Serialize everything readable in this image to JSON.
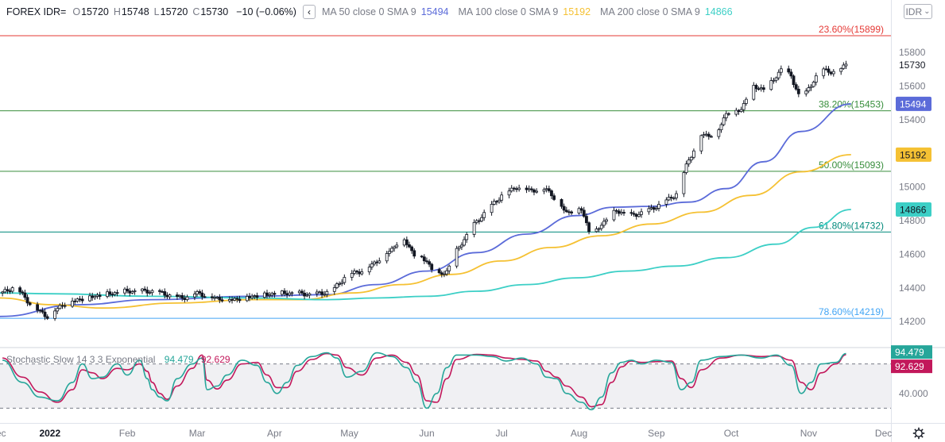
{
  "header": {
    "symbol": "FOREX IDR=",
    "open_label": "O",
    "open": "15720",
    "high_label": "H",
    "high": "15748",
    "low_label": "L",
    "low": "15720",
    "close_label": "C",
    "close": "15730",
    "change": "−10 (−0.06%)",
    "collapse_glyph": "‹",
    "ma50_label": "MA 50 close 0 SMA 9",
    "ma50_value": "15494",
    "ma100_label": "MA 100 close 0 SMA 9",
    "ma100_value": "15192",
    "ma200_label": "MA 200 close 0 SMA 9",
    "ma200_value": "14866"
  },
  "currency_select": {
    "value": "IDR",
    "glyph": "⌄"
  },
  "stochastic": {
    "title": "Stochastic Slow 14 3 3 Exponential",
    "k_value": "94.479",
    "d_value": "92.629"
  },
  "colors": {
    "ma50": "#5b6bd9",
    "ma100": "#f5c133",
    "ma200": "#3ccfc6",
    "fib_red": "#e53935",
    "fib_green": "#388e3c",
    "fib_teal": "#00897b",
    "fib_blue": "#42a5f5",
    "stoch_k": "#26a69a",
    "stoch_d": "#c2185b",
    "candle": "#131722",
    "last_price_bg": "#131722"
  },
  "chart_data": {
    "type": "candlestick",
    "y_range": [
      14050,
      15970
    ],
    "price_ticks": [
      "15800",
      "15600",
      "15400",
      "15200",
      "15000",
      "14800",
      "14600",
      "14400",
      "14200"
    ],
    "x_labels": [
      {
        "label": "Dec",
        "day": -2
      },
      {
        "label": "2022",
        "day": 19
      },
      {
        "label": "Feb",
        "day": 50
      },
      {
        "label": "Mar",
        "day": 78
      },
      {
        "label": "Apr",
        "day": 109
      },
      {
        "label": "May",
        "day": 139
      },
      {
        "label": "Jun",
        "day": 170
      },
      {
        "label": "Jul",
        "day": 200
      },
      {
        "label": "Aug",
        "day": 231
      },
      {
        "label": "Sep",
        "day": 262
      },
      {
        "label": "Oct",
        "day": 292
      },
      {
        "label": "Nov",
        "day": 323
      },
      {
        "label": "Dec",
        "day": 353
      }
    ],
    "x_range": [
      -1,
      356
    ],
    "close_anchors": [
      [
        0,
        14370
      ],
      [
        5,
        14410
      ],
      [
        12,
        14290
      ],
      [
        18,
        14230
      ],
      [
        24,
        14300
      ],
      [
        30,
        14330
      ],
      [
        40,
        14360
      ],
      [
        50,
        14380
      ],
      [
        60,
        14380
      ],
      [
        66,
        14360
      ],
      [
        72,
        14340
      ],
      [
        78,
        14370
      ],
      [
        85,
        14340
      ],
      [
        92,
        14330
      ],
      [
        100,
        14350
      ],
      [
        108,
        14365
      ],
      [
        116,
        14370
      ],
      [
        124,
        14360
      ],
      [
        132,
        14380
      ],
      [
        138,
        14480
      ],
      [
        145,
        14505
      ],
      [
        150,
        14560
      ],
      [
        156,
        14630
      ],
      [
        160,
        14705
      ],
      [
        165,
        14600
      ],
      [
        170,
        14560
      ],
      [
        174,
        14470
      ],
      [
        178,
        14500
      ],
      [
        182,
        14620
      ],
      [
        188,
        14760
      ],
      [
        194,
        14860
      ],
      [
        200,
        14950
      ],
      [
        206,
        15000
      ],
      [
        212,
        14980
      ],
      [
        218,
        14990
      ],
      [
        222,
        14920
      ],
      [
        226,
        14850
      ],
      [
        232,
        14870
      ],
      [
        236,
        14700
      ],
      [
        240,
        14780
      ],
      [
        246,
        14860
      ],
      [
        252,
        14830
      ],
      [
        258,
        14855
      ],
      [
        264,
        14900
      ],
      [
        270,
        14960
      ],
      [
        274,
        15130
      ],
      [
        280,
        15310
      ],
      [
        286,
        15310
      ],
      [
        290,
        15440
      ],
      [
        296,
        15460
      ],
      [
        300,
        15600
      ],
      [
        306,
        15580
      ],
      [
        312,
        15700
      ],
      [
        316,
        15660
      ],
      [
        320,
        15510
      ],
      [
        324,
        15610
      ],
      [
        328,
        15700
      ],
      [
        334,
        15680
      ],
      [
        338,
        15730
      ]
    ],
    "series": [
      {
        "name": "MA 50 close 0 SMA 9",
        "value": 15494,
        "points": [
          [
            -1,
            14230
          ],
          [
            30,
            14300
          ],
          [
            60,
            14330
          ],
          [
            100,
            14350
          ],
          [
            130,
            14360
          ],
          [
            150,
            14420
          ],
          [
            170,
            14500
          ],
          [
            190,
            14610
          ],
          [
            210,
            14720
          ],
          [
            230,
            14830
          ],
          [
            245,
            14880
          ],
          [
            260,
            14885
          ],
          [
            275,
            14910
          ],
          [
            290,
            14990
          ],
          [
            305,
            15150
          ],
          [
            320,
            15330
          ],
          [
            340,
            15494
          ]
        ]
      },
      {
        "name": "MA 100 close 0 SMA 9",
        "value": 15192,
        "points": [
          [
            -1,
            14340
          ],
          [
            20,
            14300
          ],
          [
            40,
            14280
          ],
          [
            70,
            14310
          ],
          [
            100,
            14330
          ],
          [
            120,
            14330
          ],
          [
            140,
            14370
          ],
          [
            160,
            14420
          ],
          [
            180,
            14480
          ],
          [
            200,
            14560
          ],
          [
            220,
            14640
          ],
          [
            240,
            14710
          ],
          [
            260,
            14780
          ],
          [
            280,
            14850
          ],
          [
            300,
            14950
          ],
          [
            320,
            15090
          ],
          [
            340,
            15192
          ]
        ]
      },
      {
        "name": "MA 200 close 0 SMA 9",
        "value": 14866,
        "points": [
          [
            -1,
            14370
          ],
          [
            20,
            14365
          ],
          [
            60,
            14350
          ],
          [
            100,
            14340
          ],
          [
            130,
            14330
          ],
          [
            150,
            14340
          ],
          [
            170,
            14350
          ],
          [
            190,
            14380
          ],
          [
            210,
            14420
          ],
          [
            230,
            14460
          ],
          [
            250,
            14500
          ],
          [
            270,
            14530
          ],
          [
            290,
            14580
          ],
          [
            310,
            14660
          ],
          [
            325,
            14760
          ],
          [
            340,
            14866
          ]
        ]
      }
    ],
    "fib_levels": [
      {
        "label": "23.60%(15899)",
        "value": 15899,
        "color_key": "fib_red"
      },
      {
        "label": "38.20%(15453)",
        "value": 15453,
        "color_key": "fib_green"
      },
      {
        "label": "50.00%(15093)",
        "value": 15093,
        "color_key": "fib_green"
      },
      {
        "label": "61.80%(14732)",
        "value": 14732,
        "color_key": "fib_teal"
      },
      {
        "label": "78.60%(14219)",
        "value": 14219,
        "color_key": "fib_blue"
      }
    ],
    "last_price": {
      "label": "15730",
      "value": 15730
    },
    "ma_badges": [
      {
        "label": "15494",
        "value": 15494,
        "color_key": "ma50",
        "text_color": "#ffffff"
      },
      {
        "label": "15192",
        "value": 15192,
        "color_key": "ma100",
        "text_color": "#131722"
      },
      {
        "label": "14866",
        "value": 14866,
        "color_key": "ma200",
        "text_color": "#131722"
      }
    ],
    "stochastic": {
      "y_range": [
        0,
        100
      ],
      "levels": [
        80,
        20
      ],
      "tick_label": "40.000",
      "k_anchors": [
        [
          0,
          85
        ],
        [
          8,
          55
        ],
        [
          15,
          35
        ],
        [
          22,
          30
        ],
        [
          28,
          55
        ],
        [
          32,
          80
        ],
        [
          36,
          60
        ],
        [
          40,
          62
        ],
        [
          46,
          80
        ],
        [
          50,
          65
        ],
        [
          55,
          85
        ],
        [
          58,
          60
        ],
        [
          60,
          45
        ],
        [
          63,
          35
        ],
        [
          66,
          30
        ],
        [
          70,
          60
        ],
        [
          76,
          80
        ],
        [
          80,
          88
        ],
        [
          82,
          45
        ],
        [
          86,
          50
        ],
        [
          90,
          65
        ],
        [
          96,
          85
        ],
        [
          102,
          78
        ],
        [
          106,
          55
        ],
        [
          110,
          40
        ],
        [
          114,
          55
        ],
        [
          118,
          78
        ],
        [
          124,
          90
        ],
        [
          130,
          95
        ],
        [
          134,
          88
        ],
        [
          138,
          62
        ],
        [
          144,
          70
        ],
        [
          150,
          95
        ],
        [
          156,
          90
        ],
        [
          162,
          75
        ],
        [
          166,
          55
        ],
        [
          170,
          20
        ],
        [
          174,
          40
        ],
        [
          178,
          75
        ],
        [
          182,
          92
        ],
        [
          190,
          92
        ],
        [
          196,
          90
        ],
        [
          202,
          84
        ],
        [
          208,
          88
        ],
        [
          214,
          80
        ],
        [
          218,
          62
        ],
        [
          222,
          60
        ],
        [
          226,
          40
        ],
        [
          232,
          28
        ],
        [
          236,
          18
        ],
        [
          240,
          35
        ],
        [
          244,
          68
        ],
        [
          248,
          82
        ],
        [
          252,
          85
        ],
        [
          256,
          80
        ],
        [
          262,
          85
        ],
        [
          268,
          82
        ],
        [
          272,
          45
        ],
        [
          276,
          55
        ],
        [
          280,
          85
        ],
        [
          288,
          90
        ],
        [
          296,
          92
        ],
        [
          304,
          88
        ],
        [
          310,
          92
        ],
        [
          316,
          78
        ],
        [
          320,
          40
        ],
        [
          324,
          55
        ],
        [
          328,
          80
        ],
        [
          334,
          82
        ],
        [
          338,
          94
        ]
      ],
      "d_anchors": [
        [
          0,
          88
        ],
        [
          8,
          62
        ],
        [
          15,
          42
        ],
        [
          22,
          28
        ],
        [
          28,
          45
        ],
        [
          32,
          72
        ],
        [
          36,
          68
        ],
        [
          40,
          60
        ],
        [
          46,
          74
        ],
        [
          50,
          72
        ],
        [
          55,
          80
        ],
        [
          58,
          70
        ],
        [
          60,
          55
        ],
        [
          63,
          40
        ],
        [
          66,
          32
        ],
        [
          70,
          50
        ],
        [
          76,
          74
        ],
        [
          80,
          92
        ],
        [
          82,
          58
        ],
        [
          86,
          46
        ],
        [
          90,
          58
        ],
        [
          96,
          80
        ],
        [
          102,
          82
        ],
        [
          106,
          65
        ],
        [
          110,
          48
        ],
        [
          114,
          48
        ],
        [
          118,
          70
        ],
        [
          124,
          86
        ],
        [
          130,
          94
        ],
        [
          134,
          92
        ],
        [
          138,
          75
        ],
        [
          144,
          65
        ],
        [
          150,
          88
        ],
        [
          156,
          92
        ],
        [
          162,
          82
        ],
        [
          166,
          65
        ],
        [
          170,
          30
        ],
        [
          174,
          28
        ],
        [
          178,
          60
        ],
        [
          182,
          86
        ],
        [
          190,
          93
        ],
        [
          196,
          92
        ],
        [
          202,
          88
        ],
        [
          208,
          86
        ],
        [
          214,
          84
        ],
        [
          218,
          70
        ],
        [
          222,
          62
        ],
        [
          226,
          50
        ],
        [
          232,
          35
        ],
        [
          236,
          22
        ],
        [
          240,
          25
        ],
        [
          244,
          55
        ],
        [
          248,
          76
        ],
        [
          252,
          84
        ],
        [
          256,
          82
        ],
        [
          262,
          83
        ],
        [
          268,
          84
        ],
        [
          272,
          60
        ],
        [
          276,
          48
        ],
        [
          280,
          72
        ],
        [
          288,
          88
        ],
        [
          296,
          92
        ],
        [
          304,
          90
        ],
        [
          310,
          91
        ],
        [
          316,
          85
        ],
        [
          320,
          55
        ],
        [
          324,
          45
        ],
        [
          328,
          68
        ],
        [
          334,
          80
        ],
        [
          338,
          92.6
        ]
      ]
    }
  }
}
